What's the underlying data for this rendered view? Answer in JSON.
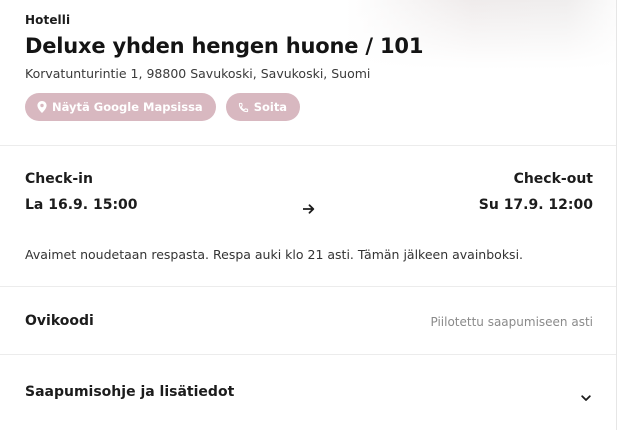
{
  "header": {
    "kicker": "Hotelli",
    "title": "Deluxe yhden hengen huone / 101",
    "address": "Korvatunturintie 1, 98800 Savukoski, Savukoski, Suomi"
  },
  "chips": {
    "maps_label": "Näytä Google Mapsissa",
    "call_label": "Soita",
    "color": "#d8b8c0"
  },
  "stay": {
    "checkin_label": "Check-in",
    "checkin_value": "La 16.9. 15:00",
    "checkout_label": "Check-out",
    "checkout_value": "Su 17.9. 12:00",
    "note": "Avaimet noudetaan respasta. Respa auki klo 21 asti. Tämän jälkeen avainboksi."
  },
  "door_code": {
    "label": "Ovikoodi",
    "status": "Piilotettu saapumiseen asti"
  },
  "arrival": {
    "label": "Saapumisohje ja lisätiedot"
  },
  "icons": [
    "location-pin-icon",
    "phone-icon",
    "arrow-right-icon",
    "chevron-down-icon"
  ]
}
